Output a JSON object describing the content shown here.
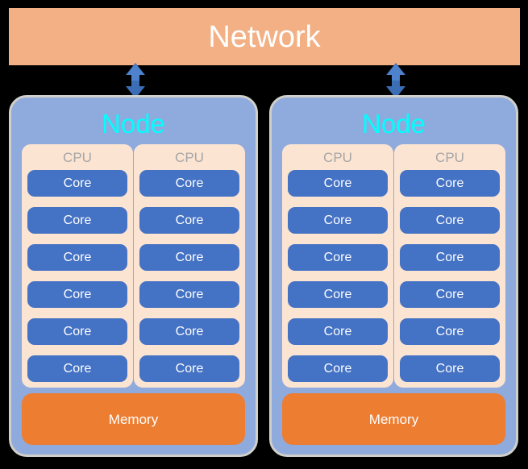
{
  "diagram": {
    "title": "Network",
    "background_color": "#000000",
    "network": {
      "label": "Network",
      "fill": "#F2B084",
      "text_color": "#FFFFFF"
    },
    "connectors": [
      {
        "name": "network-to-node-1",
        "icon": "double-arrow-vertical-icon",
        "color": "#4472C4"
      },
      {
        "name": "network-to-node-2",
        "icon": "double-arrow-vertical-icon",
        "color": "#4472C4"
      }
    ],
    "nodes": [
      {
        "label": "Node",
        "fill": "#8AA9DC",
        "text_color": "#00FFFF",
        "border_color": "#CFCFCB",
        "cpus": [
          {
            "label": "CPU",
            "fill": "#FCE4D2",
            "text_color": "#A6A6A6",
            "cores": [
              "Core",
              "Core",
              "Core",
              "Core",
              "Core",
              "Core"
            ]
          },
          {
            "label": "CPU",
            "fill": "#FCE4D2",
            "text_color": "#A6A6A6",
            "cores": [
              "Core",
              "Core",
              "Core",
              "Core",
              "Core",
              "Core"
            ]
          }
        ],
        "memory": {
          "label": "Memory",
          "fill": "#ED7D31",
          "text_color": "#FFFFFF"
        }
      },
      {
        "label": "Node",
        "fill": "#8AA9DC",
        "text_color": "#00FFFF",
        "border_color": "#CFCFCB",
        "cpus": [
          {
            "label": "CPU",
            "fill": "#FCE4D2",
            "text_color": "#A6A6A6",
            "cores": [
              "Core",
              "Core",
              "Core",
              "Core",
              "Core",
              "Core"
            ]
          },
          {
            "label": "CPU",
            "fill": "#FCE4D2",
            "text_color": "#A6A6A6",
            "cores": [
              "Core",
              "Core",
              "Core",
              "Core",
              "Core",
              "Core"
            ]
          }
        ],
        "memory": {
          "label": "Memory",
          "fill": "#ED7D31",
          "text_color": "#FFFFFF"
        }
      }
    ],
    "core_style": {
      "fill": "#4472C4",
      "text_color": "#FFFFFF"
    }
  }
}
